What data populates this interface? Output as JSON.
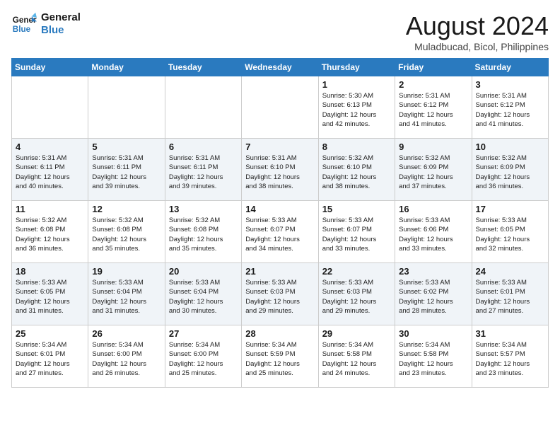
{
  "header": {
    "logo_line1": "General",
    "logo_line2": "Blue",
    "month_year": "August 2024",
    "location": "Muladbucad, Bicol, Philippines"
  },
  "days_of_week": [
    "Sunday",
    "Monday",
    "Tuesday",
    "Wednesday",
    "Thursday",
    "Friday",
    "Saturday"
  ],
  "weeks": [
    [
      {
        "day": "",
        "info": ""
      },
      {
        "day": "",
        "info": ""
      },
      {
        "day": "",
        "info": ""
      },
      {
        "day": "",
        "info": ""
      },
      {
        "day": "1",
        "info": "Sunrise: 5:30 AM\nSunset: 6:13 PM\nDaylight: 12 hours\nand 42 minutes."
      },
      {
        "day": "2",
        "info": "Sunrise: 5:31 AM\nSunset: 6:12 PM\nDaylight: 12 hours\nand 41 minutes."
      },
      {
        "day": "3",
        "info": "Sunrise: 5:31 AM\nSunset: 6:12 PM\nDaylight: 12 hours\nand 41 minutes."
      }
    ],
    [
      {
        "day": "4",
        "info": "Sunrise: 5:31 AM\nSunset: 6:11 PM\nDaylight: 12 hours\nand 40 minutes."
      },
      {
        "day": "5",
        "info": "Sunrise: 5:31 AM\nSunset: 6:11 PM\nDaylight: 12 hours\nand 39 minutes."
      },
      {
        "day": "6",
        "info": "Sunrise: 5:31 AM\nSunset: 6:11 PM\nDaylight: 12 hours\nand 39 minutes."
      },
      {
        "day": "7",
        "info": "Sunrise: 5:31 AM\nSunset: 6:10 PM\nDaylight: 12 hours\nand 38 minutes."
      },
      {
        "day": "8",
        "info": "Sunrise: 5:32 AM\nSunset: 6:10 PM\nDaylight: 12 hours\nand 38 minutes."
      },
      {
        "day": "9",
        "info": "Sunrise: 5:32 AM\nSunset: 6:09 PM\nDaylight: 12 hours\nand 37 minutes."
      },
      {
        "day": "10",
        "info": "Sunrise: 5:32 AM\nSunset: 6:09 PM\nDaylight: 12 hours\nand 36 minutes."
      }
    ],
    [
      {
        "day": "11",
        "info": "Sunrise: 5:32 AM\nSunset: 6:08 PM\nDaylight: 12 hours\nand 36 minutes."
      },
      {
        "day": "12",
        "info": "Sunrise: 5:32 AM\nSunset: 6:08 PM\nDaylight: 12 hours\nand 35 minutes."
      },
      {
        "day": "13",
        "info": "Sunrise: 5:32 AM\nSunset: 6:08 PM\nDaylight: 12 hours\nand 35 minutes."
      },
      {
        "day": "14",
        "info": "Sunrise: 5:33 AM\nSunset: 6:07 PM\nDaylight: 12 hours\nand 34 minutes."
      },
      {
        "day": "15",
        "info": "Sunrise: 5:33 AM\nSunset: 6:07 PM\nDaylight: 12 hours\nand 33 minutes."
      },
      {
        "day": "16",
        "info": "Sunrise: 5:33 AM\nSunset: 6:06 PM\nDaylight: 12 hours\nand 33 minutes."
      },
      {
        "day": "17",
        "info": "Sunrise: 5:33 AM\nSunset: 6:05 PM\nDaylight: 12 hours\nand 32 minutes."
      }
    ],
    [
      {
        "day": "18",
        "info": "Sunrise: 5:33 AM\nSunset: 6:05 PM\nDaylight: 12 hours\nand 31 minutes."
      },
      {
        "day": "19",
        "info": "Sunrise: 5:33 AM\nSunset: 6:04 PM\nDaylight: 12 hours\nand 31 minutes."
      },
      {
        "day": "20",
        "info": "Sunrise: 5:33 AM\nSunset: 6:04 PM\nDaylight: 12 hours\nand 30 minutes."
      },
      {
        "day": "21",
        "info": "Sunrise: 5:33 AM\nSunset: 6:03 PM\nDaylight: 12 hours\nand 29 minutes."
      },
      {
        "day": "22",
        "info": "Sunrise: 5:33 AM\nSunset: 6:03 PM\nDaylight: 12 hours\nand 29 minutes."
      },
      {
        "day": "23",
        "info": "Sunrise: 5:33 AM\nSunset: 6:02 PM\nDaylight: 12 hours\nand 28 minutes."
      },
      {
        "day": "24",
        "info": "Sunrise: 5:33 AM\nSunset: 6:01 PM\nDaylight: 12 hours\nand 27 minutes."
      }
    ],
    [
      {
        "day": "25",
        "info": "Sunrise: 5:34 AM\nSunset: 6:01 PM\nDaylight: 12 hours\nand 27 minutes."
      },
      {
        "day": "26",
        "info": "Sunrise: 5:34 AM\nSunset: 6:00 PM\nDaylight: 12 hours\nand 26 minutes."
      },
      {
        "day": "27",
        "info": "Sunrise: 5:34 AM\nSunset: 6:00 PM\nDaylight: 12 hours\nand 25 minutes."
      },
      {
        "day": "28",
        "info": "Sunrise: 5:34 AM\nSunset: 5:59 PM\nDaylight: 12 hours\nand 25 minutes."
      },
      {
        "day": "29",
        "info": "Sunrise: 5:34 AM\nSunset: 5:58 PM\nDaylight: 12 hours\nand 24 minutes."
      },
      {
        "day": "30",
        "info": "Sunrise: 5:34 AM\nSunset: 5:58 PM\nDaylight: 12 hours\nand 23 minutes."
      },
      {
        "day": "31",
        "info": "Sunrise: 5:34 AM\nSunset: 5:57 PM\nDaylight: 12 hours\nand 23 minutes."
      }
    ]
  ]
}
